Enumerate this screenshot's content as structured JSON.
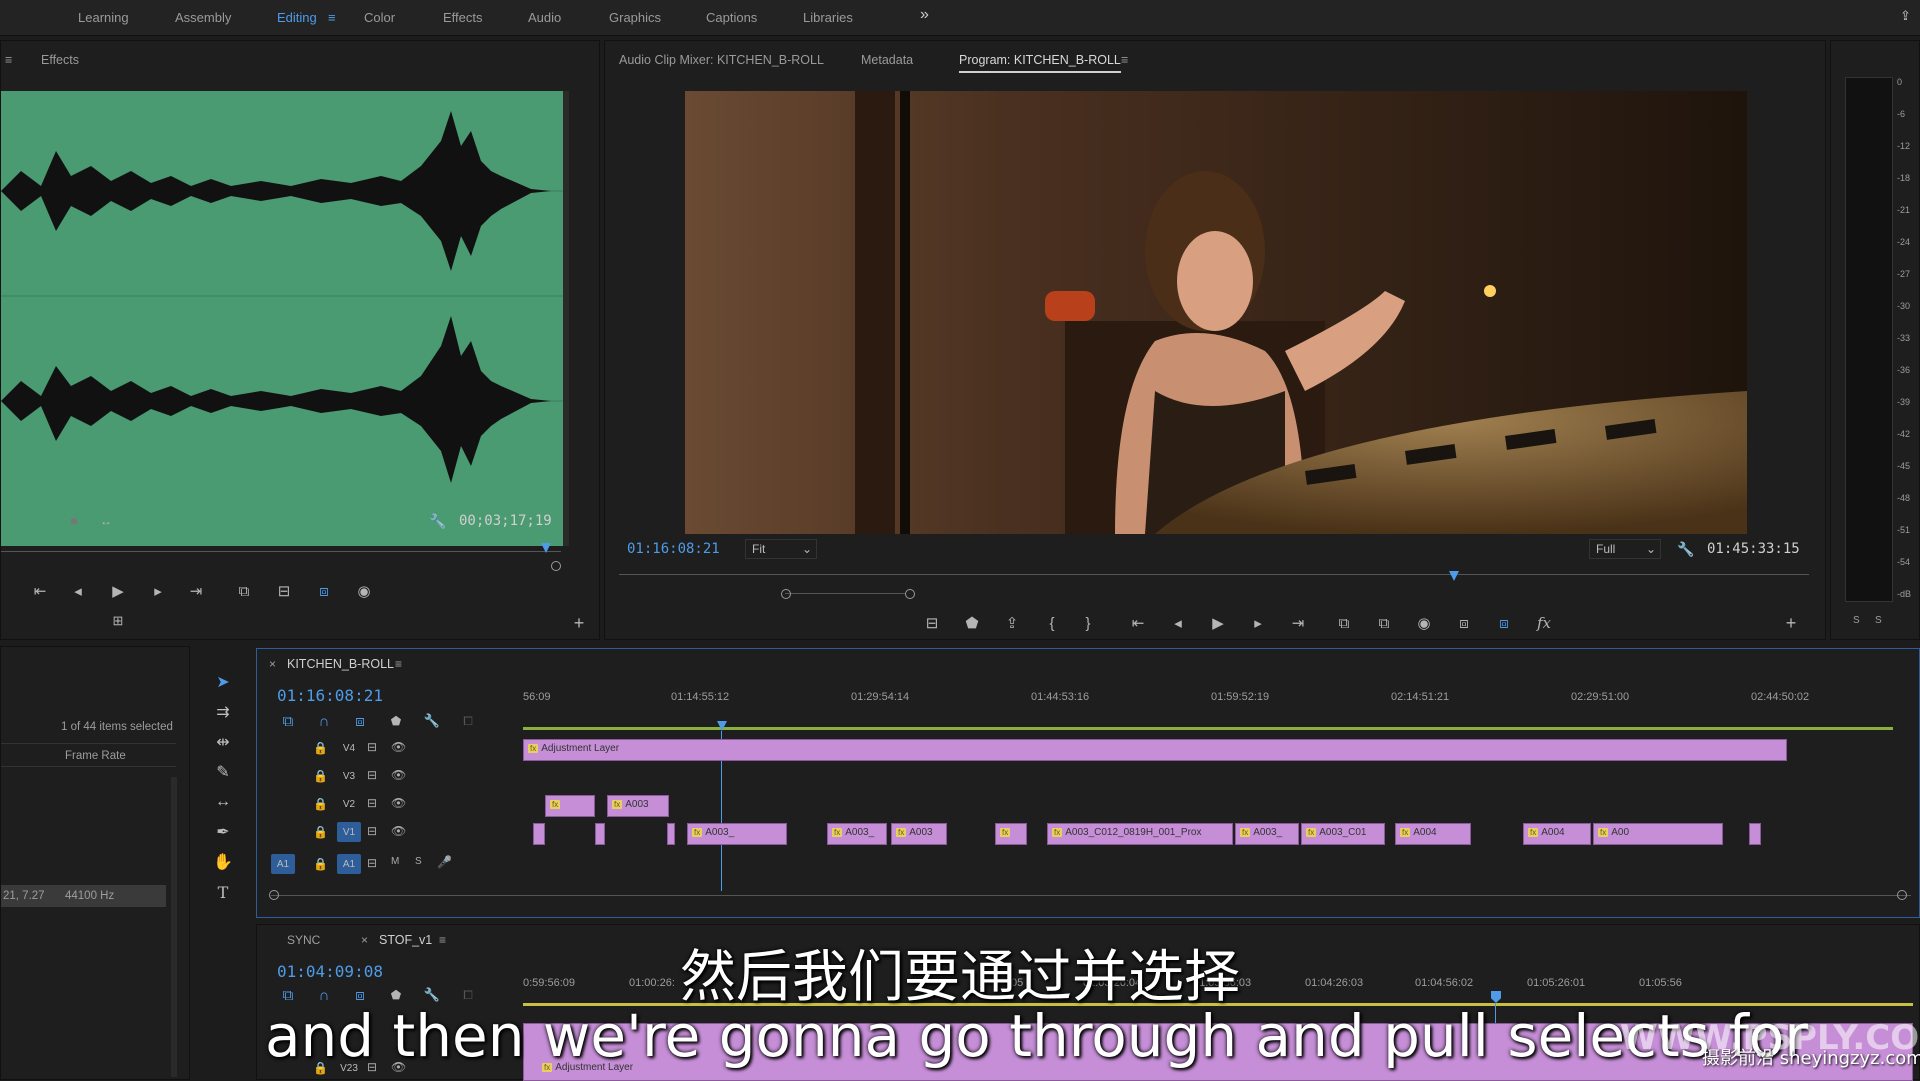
{
  "workspaces": {
    "items": [
      "Learning",
      "Assembly",
      "Editing",
      "Color",
      "Effects",
      "Audio",
      "Graphics",
      "Captions",
      "Libraries"
    ],
    "active": "Editing",
    "overflow": "»"
  },
  "source_panel": {
    "tab": "Effects",
    "timecode": "00;03;17;19"
  },
  "program_panel": {
    "tabs": [
      "Audio Clip Mixer: KITCHEN_B-ROLL",
      "Metadata",
      "Program: KITCHEN_B-ROLL"
    ],
    "active_tab": "Program: KITCHEN_B-ROLL",
    "timecode": "01:16:08:21",
    "fit": "Fit",
    "quality": "Full",
    "duration": "01:45:33:15"
  },
  "meter": {
    "scale": [
      "0",
      "-6",
      "-12",
      "-18",
      "-21",
      "-24",
      "-27",
      "-30",
      "-33",
      "-36",
      "-39",
      "-42",
      "-45",
      "-48",
      "-51",
      "-54",
      "-dB"
    ],
    "buttons": [
      "S",
      "S"
    ]
  },
  "project_panel": {
    "selection": "1 of 44 items selected",
    "column": "Frame Rate",
    "row_left": "21, 7.27",
    "row_value": "44100 Hz"
  },
  "timeline": {
    "sequence": "KITCHEN_B-ROLL",
    "timecode": "01:16:08:21",
    "ruler": [
      "56:09",
      "01:14:55:12",
      "01:29:54:14",
      "01:44:53:16",
      "01:59:52:19",
      "02:14:51:21",
      "02:29:51:00",
      "02:44:50:02"
    ],
    "tracks": [
      {
        "name": "V4",
        "type": "video"
      },
      {
        "name": "V3",
        "type": "video"
      },
      {
        "name": "V2",
        "type": "video"
      },
      {
        "name": "V1",
        "type": "video"
      },
      {
        "name": "A1",
        "type": "audio",
        "src": "A1",
        "m": "M",
        "s": "S"
      }
    ],
    "adjustment_label": "Adjustment Layer",
    "v2_clips": [
      "",
      "A003"
    ],
    "v1_clips": [
      "A003_",
      "A003_",
      "A003",
      "",
      "A003_C012_0819H_001_Prox",
      "A003_",
      "A003_C01",
      "A004",
      "A004",
      "A00"
    ]
  },
  "timeline2": {
    "tabs": [
      "SYNC",
      "STOF_v1"
    ],
    "timecode": "01:04:09:08",
    "ruler": [
      "0:59:56:09",
      "01:00:26:",
      "05",
      "01:03:26:04",
      "01:03:56:03",
      "01:04:26:03",
      "01:04:56:02",
      "01:05:26:01",
      "01:05:56"
    ],
    "track": "V23",
    "adjustment_label": "Adjustment Layer"
  },
  "subtitles": {
    "chinese": "然后我们要通过并选择",
    "english": "and then we're gonna go through and pull selects for"
  },
  "watermark": {
    "url": "WWW.PSPLY.COM",
    "cn": "摄影前沿 sheyingzyz.com"
  },
  "colors": {
    "accent": "#4e9be8",
    "clip": "#c58ed6",
    "waveform_bg": "#4a9a72"
  }
}
